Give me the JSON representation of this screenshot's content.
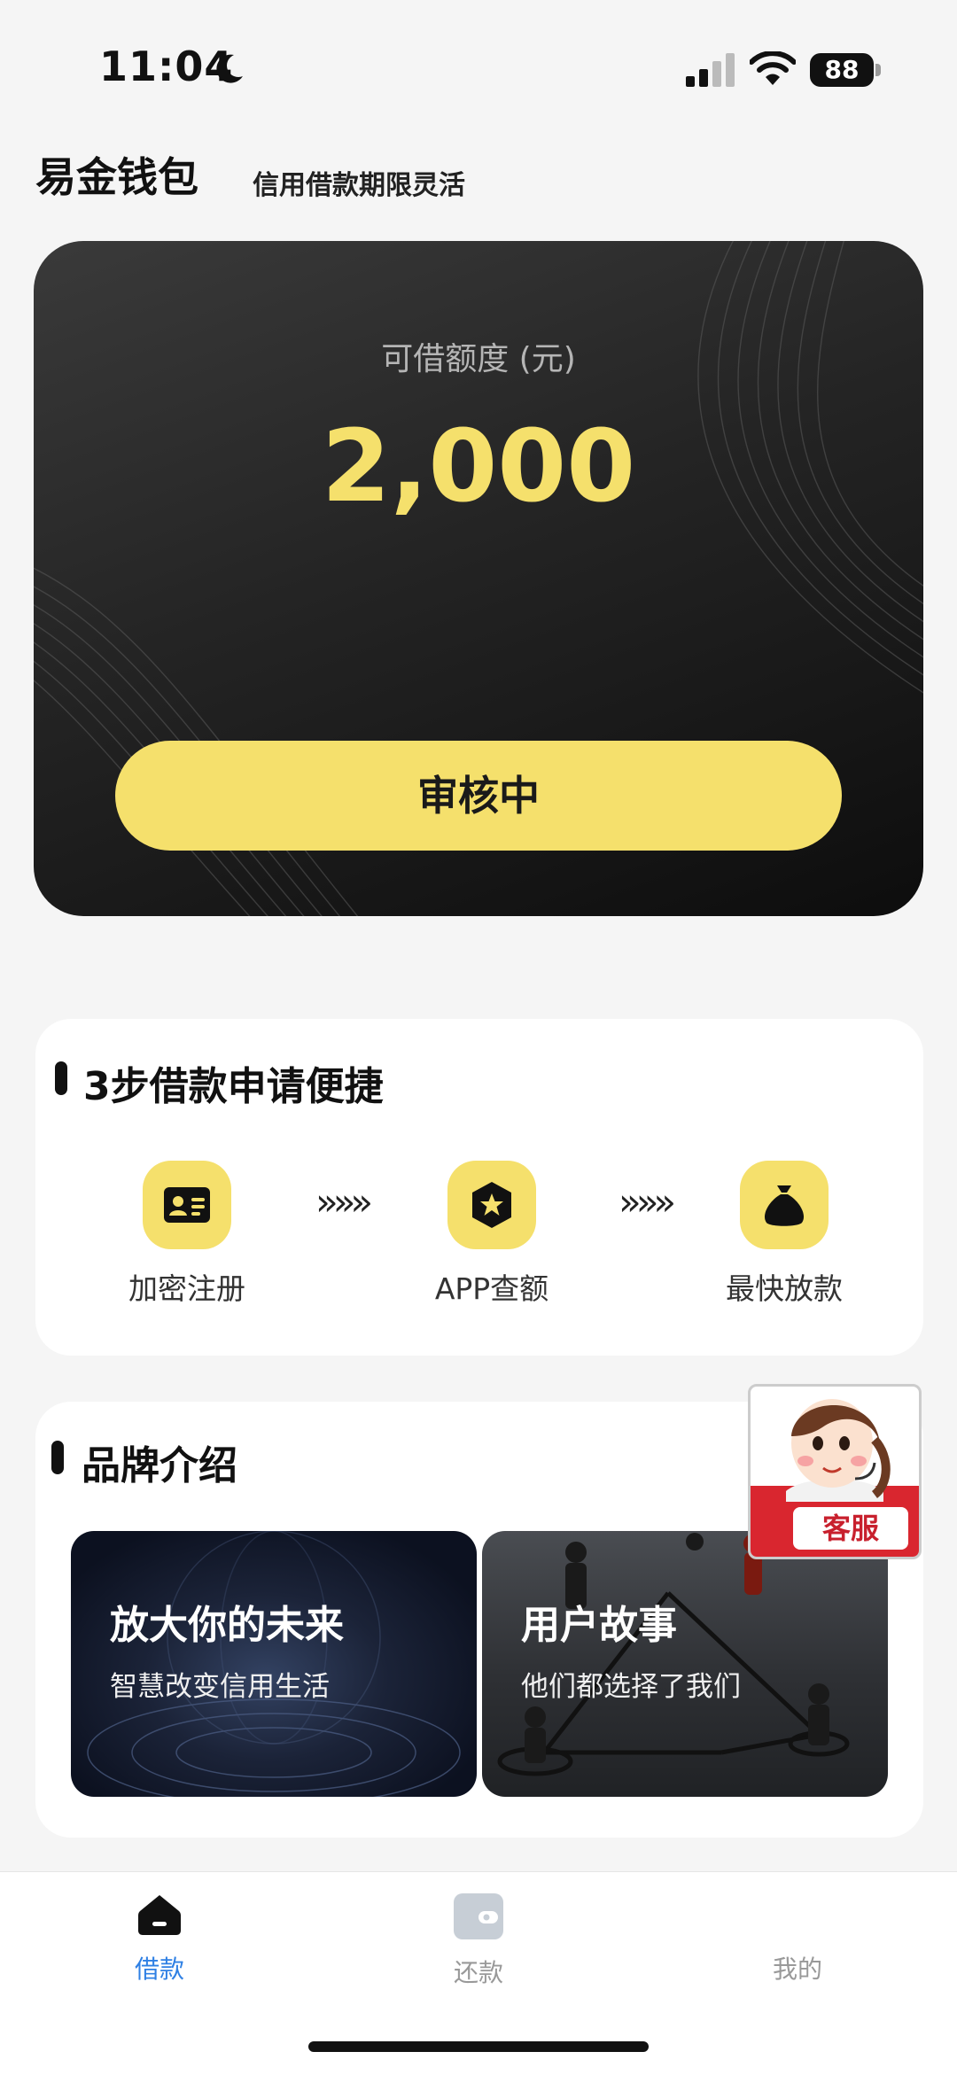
{
  "status_bar": {
    "time": "11:04",
    "battery": "88"
  },
  "header": {
    "title": "易金钱包",
    "slogan": "信用借款期限灵活"
  },
  "hero": {
    "label": "可借额度 (元)",
    "amount": "2,000",
    "button_label": "审核中"
  },
  "steps": {
    "title": "3步借款申请便捷",
    "items": [
      {
        "label": "加密注册",
        "icon": "id-card-icon"
      },
      {
        "label": "APP查额",
        "icon": "star-badge-icon"
      },
      {
        "label": "最快放款",
        "icon": "money-bag-icon"
      }
    ],
    "arrow": "»»»"
  },
  "brand": {
    "title": "品牌介绍",
    "tiles": [
      {
        "title": "放大你的未来",
        "subtitle": "智慧改变信用生活"
      },
      {
        "title": "用户故事",
        "subtitle": "他们都选择了我们"
      }
    ]
  },
  "service": {
    "label": "客服"
  },
  "tabs": [
    {
      "label": "借款",
      "icon": "home-icon",
      "active": true
    },
    {
      "label": "还款",
      "icon": "wallet-icon",
      "active": false
    },
    {
      "label": "我的",
      "icon": "profile-icon",
      "active": false
    }
  ],
  "colors": {
    "accent": "#f5e06c",
    "tab_active": "#2f80e4",
    "tab_inactive": "#999999",
    "service_red": "#c8202d"
  }
}
